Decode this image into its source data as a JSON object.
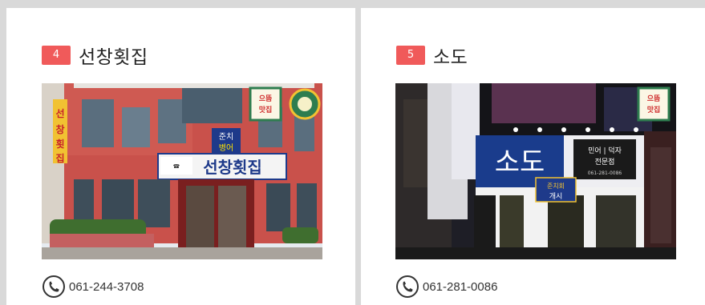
{
  "restaurants": [
    {
      "rank": "4",
      "name": "선창횟집",
      "phone": "061-244-3708",
      "sign_main": "선창횟집",
      "sign_side": "선창횟집",
      "sign_small_1": "준치",
      "sign_small_2": "병어",
      "sticker": "으뜸 맛집",
      "colors": {
        "building": "#c8504a",
        "sky": "#e8eef4"
      }
    },
    {
      "rank": "5",
      "name": "소도",
      "phone": "061-281-0086",
      "sign_main": "소도",
      "sign_sub_1": "민어 | 덕자",
      "sign_sub_2": "전문점",
      "sign_phone": "061-281-0086",
      "sign_special_1": "준치회",
      "sign_special_2": "개시",
      "sticker": "으뜸 맛집",
      "colors": {
        "building": "#2a2a34",
        "accent": "#1a3c8c"
      }
    }
  ],
  "colors": {
    "badge": "#f05a5a",
    "background": "#d9d9d9",
    "card": "#ffffff"
  },
  "icons": {
    "phone": "phone-icon"
  }
}
